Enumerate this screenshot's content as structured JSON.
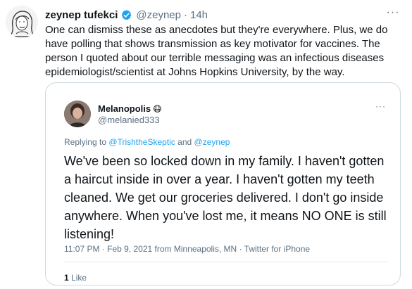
{
  "tweet": {
    "display_name": "zeynep tufekci",
    "handle": "@zeynep",
    "separator": "·",
    "time": "14h",
    "more": "···",
    "text": "One can dismiss these as anecdotes but they're everywhere. Plus, we do have polling that shows transmission as key motivator for vaccines. The person I quoted about our terrible messaging was an infectious diseases epidemiologist/scientist at Johns Hopkins University, by the way."
  },
  "quoted": {
    "display_name": "Melanopolis",
    "name_emoji": "😷",
    "handle": "@melanied333",
    "more": "···",
    "replying_prefix": "Replying to",
    "replying_user1": "@TrishtheSkeptic",
    "replying_and": "and",
    "replying_user2": "@zeynep",
    "text": "We've been so locked down in my family. I haven't gotten a haircut inside in over a year. I haven't gotten my teeth cleaned. We get our groceries delivered. I don't go inside anywhere. When you've lost me, it means NO ONE is still listening!",
    "meta": "11:07 PM · Feb 9, 2021 from Minneapolis, MN · Twitter for iPhone",
    "likes_count": "1",
    "likes_label": "Like"
  },
  "colors": {
    "accent": "#1da1f2",
    "secondary_text": "#5b7083",
    "border": "#cfd9de"
  }
}
